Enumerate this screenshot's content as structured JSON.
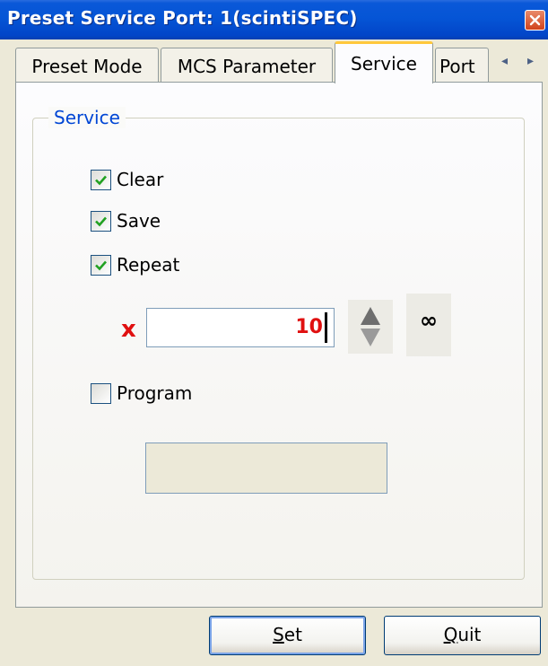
{
  "window": {
    "title": "Preset Service Port: 1(scintiSPEC)"
  },
  "tabs": [
    {
      "label": "Preset Mode",
      "active": false
    },
    {
      "label": "MCS Parameter",
      "active": false
    },
    {
      "label": "Service",
      "active": true
    },
    {
      "label": "Port",
      "active": false
    }
  ],
  "tab_scroll": {
    "left": "◂",
    "right": "▸"
  },
  "group": {
    "legend": "Service"
  },
  "options": {
    "clear": {
      "label": "Clear",
      "checked": true
    },
    "save": {
      "label": "Save",
      "checked": true
    },
    "repeat": {
      "label": "Repeat",
      "checked": true
    },
    "program": {
      "label": "Program",
      "checked": false
    }
  },
  "repeat_count": {
    "multiplier_symbol": "x",
    "value": "10",
    "infinity_symbol": "∞"
  },
  "buttons": {
    "set": {
      "mnemonic": "S",
      "rest": "et"
    },
    "quit": {
      "mnemonic": "Q",
      "rest": "uit"
    }
  },
  "colors": {
    "title_bar": "#0555D6",
    "accent_red": "#E01010",
    "legend_blue": "#0046D5",
    "active_tab_highlight": "#FFC83C"
  }
}
